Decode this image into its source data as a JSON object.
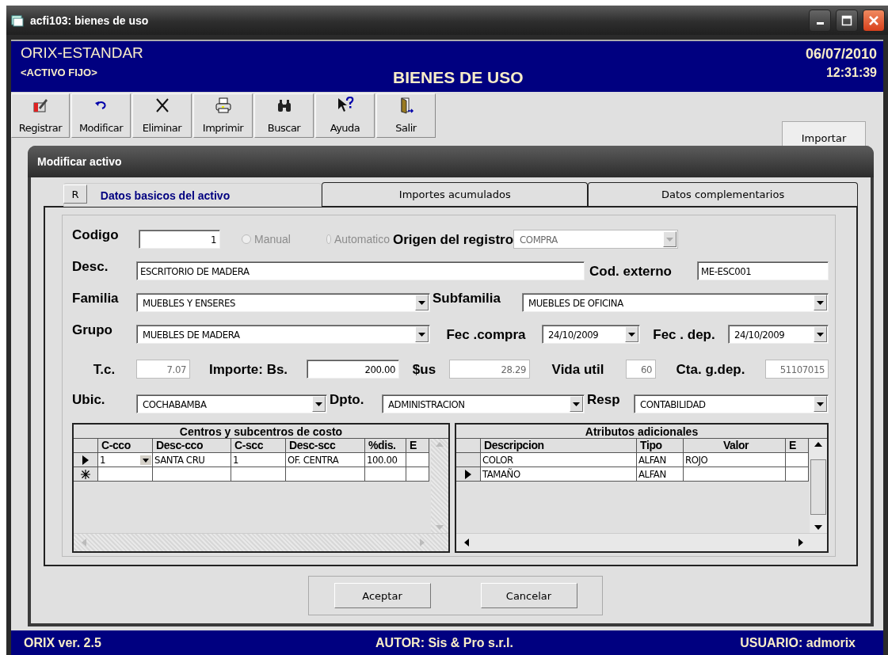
{
  "window": {
    "title": "acfi103: bienes de uso"
  },
  "header": {
    "app": "ORIX-ESTANDAR",
    "module": "<ACTIVO FIJO>",
    "title": "BIENES DE USO",
    "date": "06/07/2010",
    "time": "12:31:39"
  },
  "toolbar": [
    {
      "label": "Registrar",
      "kind": "register"
    },
    {
      "label": "Modificar",
      "kind": "undo"
    },
    {
      "label": "Eliminar",
      "kind": "delete"
    },
    {
      "label": "Imprimir",
      "kind": "print"
    },
    {
      "label": "Buscar",
      "kind": "search"
    },
    {
      "label": "Ayuda",
      "kind": "help"
    },
    {
      "label": "Salir",
      "kind": "exit"
    }
  ],
  "import_button": "Importar",
  "dialog": {
    "title": "Modificar activo",
    "r_button": "R",
    "tabs": [
      {
        "label": "Datos basicos del activo",
        "selected": true
      },
      {
        "label": "Importes acumulados",
        "selected": false
      },
      {
        "label": "Datos complementarios",
        "selected": false
      }
    ],
    "form": [
      {
        "items": [
          {
            "kind": "label",
            "text": "Codigo"
          },
          {
            "kind": "number",
            "value": "1",
            "disabled": false
          },
          {
            "kind": "radio",
            "label": "Manual",
            "checked": false,
            "disabled": true
          },
          {
            "kind": "radio",
            "label": "Automatico",
            "checked": false,
            "disabled": true
          },
          {
            "kind": "label",
            "text": "Origen del registro"
          },
          {
            "kind": "combo",
            "value": "COMPRA",
            "disabled": true
          }
        ]
      },
      {
        "items": [
          {
            "kind": "label",
            "text": "Desc."
          },
          {
            "kind": "text",
            "value": "ESCRITORIO DE MADERA",
            "disabled": false
          },
          {
            "kind": "label",
            "text": "Cod. externo"
          },
          {
            "kind": "text",
            "value": "ME-ESC001",
            "disabled": false
          }
        ]
      },
      {
        "items": [
          {
            "kind": "label",
            "text": "Familia"
          },
          {
            "kind": "combo",
            "value": "MUEBLES Y ENSERES",
            "disabled": false
          },
          {
            "kind": "label",
            "text": "Subfamilia"
          },
          {
            "kind": "combo",
            "value": "MUEBLES DE OFICINA",
            "disabled": false
          }
        ]
      },
      {
        "items": [
          {
            "kind": "label",
            "text": "Grupo"
          },
          {
            "kind": "combo",
            "value": "MUEBLES DE MADERA",
            "disabled": false
          },
          {
            "kind": "label",
            "text": "Fec .compra"
          },
          {
            "kind": "combo",
            "value": "24/10/2009",
            "disabled": false
          },
          {
            "kind": "label",
            "text": "Fec . dep."
          },
          {
            "kind": "combo",
            "value": "24/10/2009",
            "disabled": false
          }
        ]
      },
      {
        "items": [
          {
            "kind": "label",
            "text": "T.c."
          },
          {
            "kind": "number",
            "value": "7.07",
            "disabled": true
          },
          {
            "kind": "label",
            "text": "Importe: Bs."
          },
          {
            "kind": "number",
            "value": "200.00",
            "disabled": false
          },
          {
            "kind": "label",
            "text": "$us"
          },
          {
            "kind": "number",
            "value": "28.29",
            "disabled": true
          },
          {
            "kind": "label",
            "text": "Vida util"
          },
          {
            "kind": "number",
            "value": "60",
            "disabled": true
          },
          {
            "kind": "label",
            "text": "Cta. g.dep."
          },
          {
            "kind": "number",
            "value": "51107015",
            "disabled": true
          }
        ]
      },
      {
        "items": [
          {
            "kind": "label",
            "text": "Ubic."
          },
          {
            "kind": "combo",
            "value": "COCHABAMBA",
            "disabled": false
          },
          {
            "kind": "label",
            "text": "Dpto."
          },
          {
            "kind": "combo",
            "value": "ADMINISTRACION",
            "disabled": false
          },
          {
            "kind": "label",
            "text": "Resp"
          },
          {
            "kind": "combo",
            "value": "CONTABILIDAD",
            "disabled": false
          }
        ]
      }
    ],
    "grids": [
      {
        "title": "Centros y subcentros de costo",
        "scrollbars_disabled": true,
        "columns": [
          "C-cco",
          "Desc-cco",
          "C-scc",
          "Desc-scc",
          "%dis.",
          "E"
        ],
        "rows": [
          {
            "current": true,
            "new_row": false,
            "first_cell_dropdown": true,
            "cells": [
              "1",
              "SANTA CRU",
              "1",
              "OF. CENTRA",
              "100.00"
            ]
          },
          {
            "current": false,
            "new_row": true,
            "first_cell_dropdown": false
          }
        ]
      },
      {
        "title": "Atributos adicionales",
        "scrollbars_disabled": false,
        "columns": [
          "Descripcion",
          "Tipo",
          "Valor",
          "E"
        ],
        "rows": [
          {
            "current": false,
            "new_row": false,
            "first_cell_dropdown": false,
            "cells": [
              "COLOR",
              "ALFAN",
              "ROJO"
            ]
          },
          {
            "current": true,
            "new_row": false,
            "first_cell_dropdown": false,
            "cells": [
              "TAMAÑO",
              "ALFAN"
            ]
          }
        ]
      }
    ],
    "buttons": [
      "Aceptar",
      "Cancelar"
    ]
  },
  "status_bar": {
    "version": "ORIX ver. 2.5",
    "author": "AUTOR: Sis & Pro s.r.l.",
    "user": "USUARIO: admorix"
  }
}
